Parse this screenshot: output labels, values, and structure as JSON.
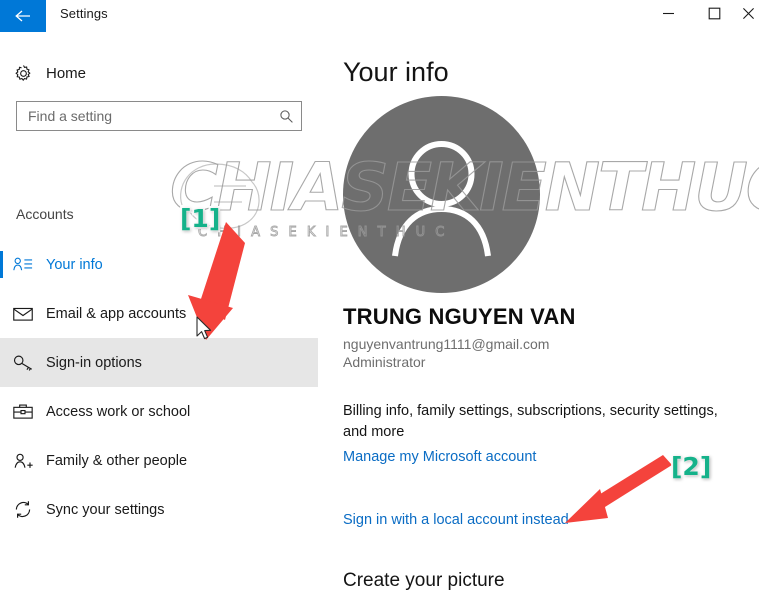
{
  "window": {
    "title": "Settings",
    "back_icon": "back-arrow-icon",
    "minimize_label": "—",
    "maximize_label": "□",
    "close_label": "✕"
  },
  "sidebar": {
    "home": {
      "label": "Home",
      "icon": "gear-icon"
    },
    "search": {
      "value": "",
      "placeholder": "Find a setting",
      "icon": "search-icon"
    },
    "section_title": "Accounts",
    "items": [
      {
        "label": "Your info",
        "icon": "person-list-icon",
        "state": "selected"
      },
      {
        "label": "Email & app accounts",
        "icon": "envelope-icon",
        "state": "normal"
      },
      {
        "label": "Sign-in options",
        "icon": "key-icon",
        "state": "hovered"
      },
      {
        "label": "Access work or school",
        "icon": "briefcase-icon",
        "state": "normal"
      },
      {
        "label": "Family & other people",
        "icon": "person-plus-icon",
        "state": "normal"
      },
      {
        "label": "Sync your settings",
        "icon": "sync-icon",
        "state": "normal"
      }
    ]
  },
  "main": {
    "page_title": "Your info",
    "avatar_icon": "person-avatar-icon",
    "account_name": "TRUNG NGUYEN VAN",
    "account_email": "nguyenvantrung1111@gmail.com",
    "account_role": "Administrator",
    "billing_text": "Billing info, family settings, subscriptions, security settings, and more",
    "manage_link": "Manage my Microsoft account",
    "local_account_link": "Sign in with a local account instead",
    "create_picture_title": "Create your picture"
  },
  "watermark": {
    "main_text": "CHIASEKIENTHUC",
    "sub_text": "C H I A   S E   K I E N   T H U C"
  },
  "annotations": {
    "badge_1": "[1]",
    "badge_2": "[2]",
    "arrow_1": "red-arrow-icon",
    "arrow_2": "red-arrow-icon",
    "cursor": "mouse-pointer-icon"
  },
  "colors": {
    "accent": "#0078d7",
    "link": "#0a6cc4",
    "hover_row": "#e6e6e6",
    "avatar_gray": "#6e6e6e",
    "annotation_red": "#f4433c",
    "badge_teal": "#15b28a"
  }
}
